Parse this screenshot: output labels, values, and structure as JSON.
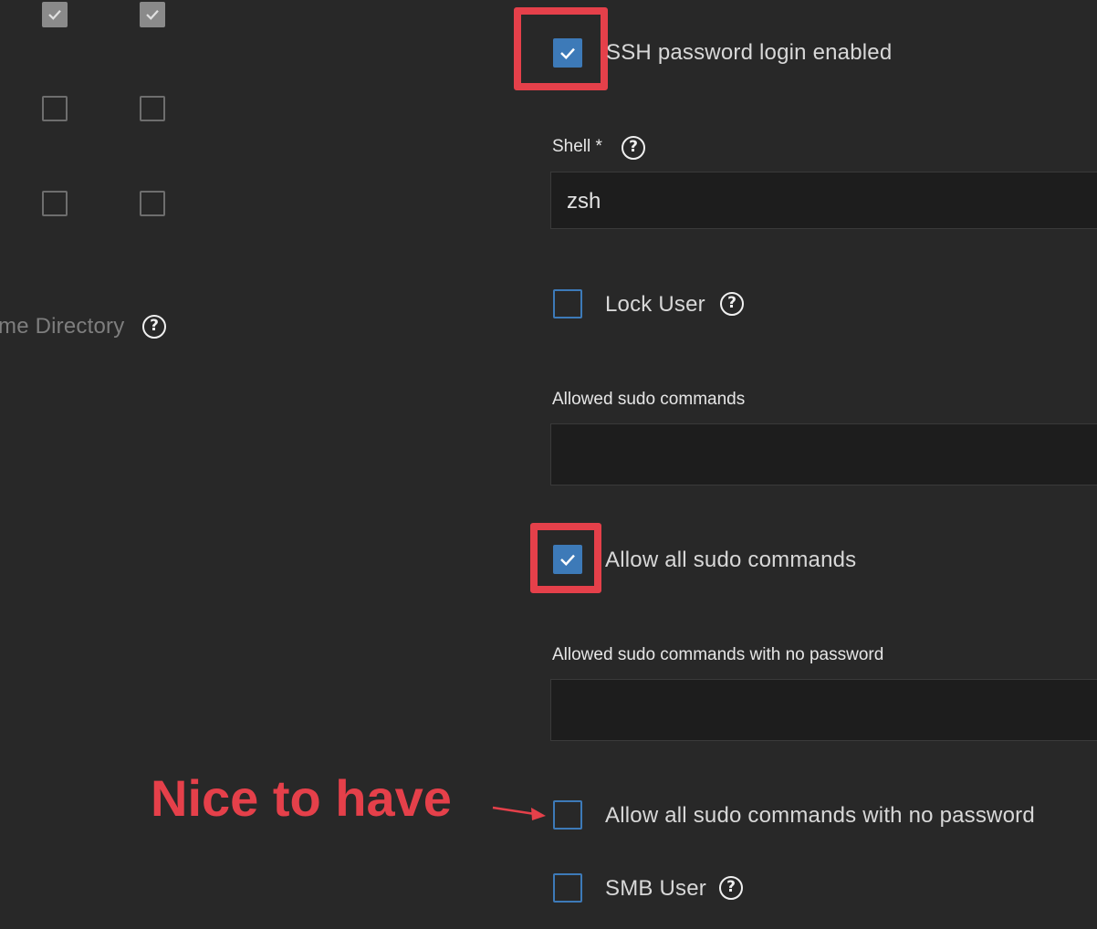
{
  "left_panel": {
    "home_directory_label": "me Directory"
  },
  "ssh_password_login": {
    "label": "SSH password login enabled",
    "checked": true
  },
  "shell": {
    "label": "Shell *",
    "value": "zsh"
  },
  "lock_user": {
    "label": "Lock User",
    "checked": false
  },
  "sudo_commands": {
    "label": "Allowed sudo commands",
    "value": ""
  },
  "allow_all_sudo": {
    "label": "Allow all sudo commands",
    "checked": true
  },
  "sudo_nopasswd": {
    "label": "Allowed sudo commands with no password",
    "value": ""
  },
  "allow_all_sudo_nopasswd": {
    "label": "Allow all sudo commands with no password",
    "checked": false
  },
  "smb_user": {
    "label": "SMB User",
    "checked": false
  },
  "annotation": {
    "text": "Nice to have"
  },
  "colors": {
    "highlight": "#e5404a",
    "checkbox_blue": "#3d7ab8",
    "background": "#282828"
  }
}
